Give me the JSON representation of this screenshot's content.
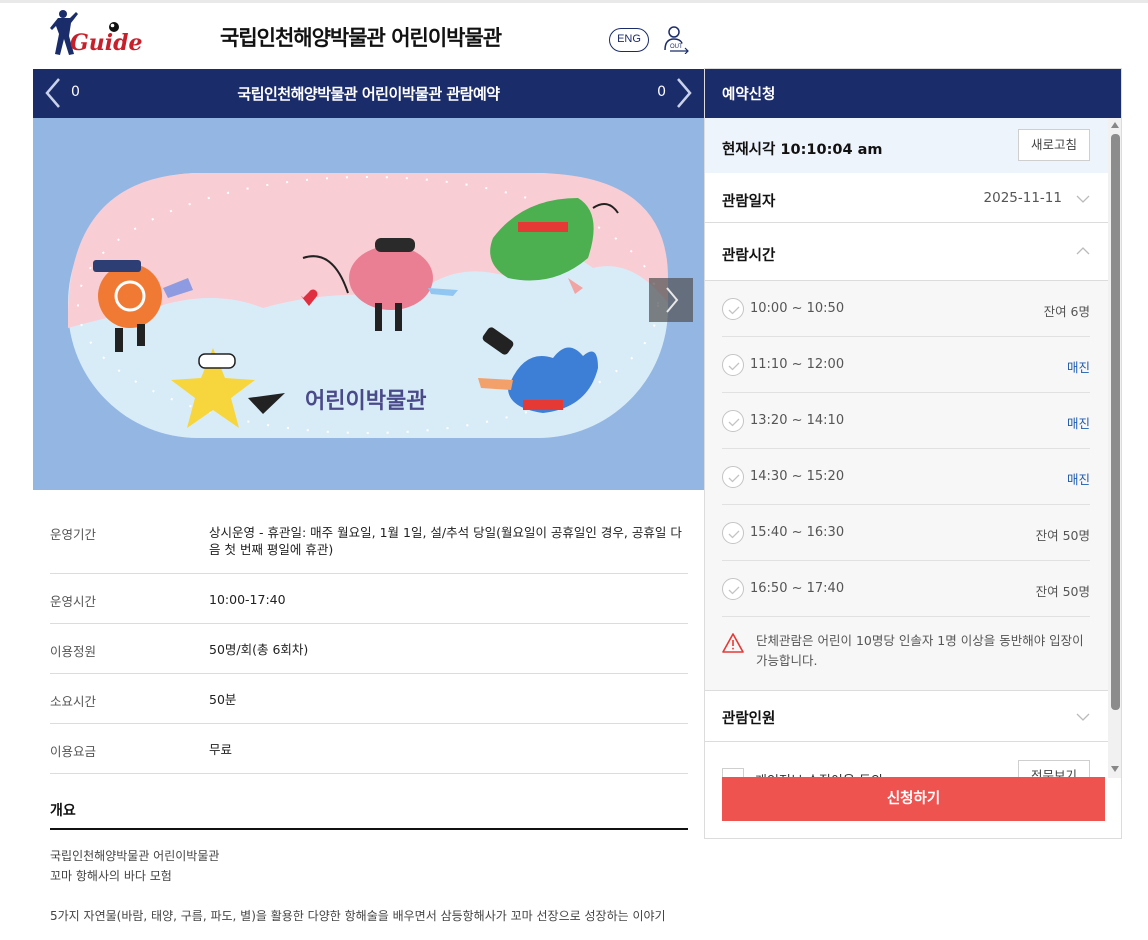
{
  "header": {
    "logo_text": "Guide",
    "site_title": "국립인천해양박물관 어린이박물관",
    "eng_label": "ENG",
    "logout_label": "OUT"
  },
  "gallery": {
    "title": "국립인천해양박물관 어린이박물관 관람예약",
    "count_left": "0",
    "count_right": "0",
    "banner_text": "어린이박물관",
    "dots": 5,
    "active_dot": 0
  },
  "info": {
    "rows": [
      {
        "key": "운영기간",
        "value": "상시운영 - 휴관일: 매주 월요일, 1월 1일, 설/추석 당일(월요일이 공휴일인 경우, 공휴일 다음 첫 번째 평일에 휴관)"
      },
      {
        "key": "운영시간",
        "value": "10:00-17:40"
      },
      {
        "key": "이용정원",
        "value": "50명/회(총 6회차)"
      },
      {
        "key": "소요시간",
        "value": "50분"
      },
      {
        "key": "이용요금",
        "value": "무료"
      }
    ]
  },
  "overview": {
    "title": "개요",
    "line1": "국립인천해양박물관 어린이박물관",
    "line2": "꼬마 항해사의 바다 모험",
    "line3": "5가지 자연물(바람, 태양, 구름, 파도, 별)을 활용한 다양한 항해술을 배우면서 삼등항해사가 꼬마 선장으로 성장하는 이야기"
  },
  "reservation": {
    "title": "예약신청",
    "now_label": "현재시각 10:10:04 am",
    "refresh_label": "새로고침",
    "date_label": "관람일자",
    "date_value": "2025-11-11",
    "time_label": "관람시간",
    "slots": [
      {
        "time": "10:00 ~ 10:50",
        "status": "잔여 6명",
        "sold": false
      },
      {
        "time": "11:10 ~ 12:00",
        "status": "매진",
        "sold": true
      },
      {
        "time": "13:20 ~ 14:10",
        "status": "매진",
        "sold": true
      },
      {
        "time": "14:30 ~ 15:20",
        "status": "매진",
        "sold": true
      },
      {
        "time": "15:40 ~ 16:30",
        "status": "잔여 50명",
        "sold": false
      },
      {
        "time": "16:50 ~ 17:40",
        "status": "잔여 50명",
        "sold": false
      }
    ],
    "notice": "단체관람은 어린이 10명당 인솔자 1명 이상을 동반해야 입장이 가능합니다.",
    "people_label": "관람인원",
    "agree_label": "개인정보 수집이용 동의",
    "view_label": "전문보기",
    "apply_label": "신청하기"
  },
  "colors": {
    "navy": "#1b2c6b",
    "apply": "#ef5350",
    "sold_out": "#1f5bb0",
    "warn": "#e53935"
  }
}
